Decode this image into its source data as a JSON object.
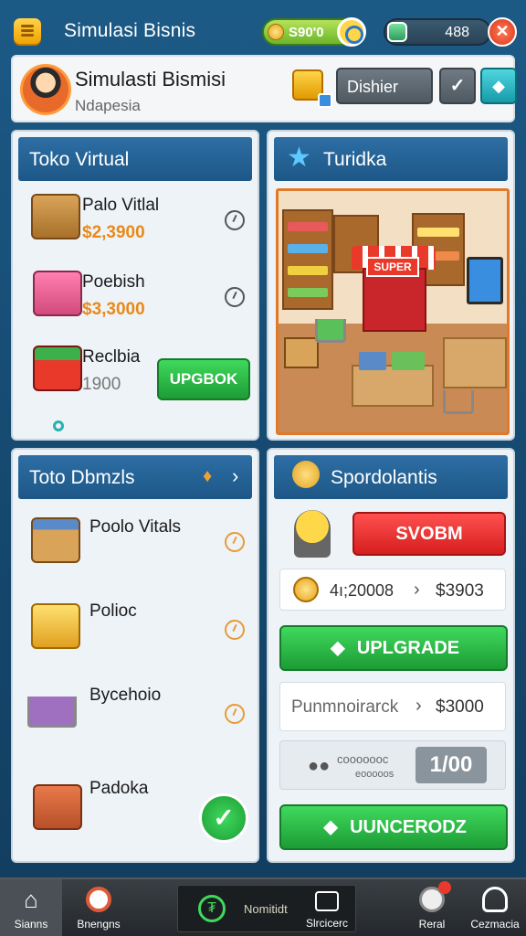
{
  "header": {
    "title": "Simulasi Bisnis",
    "money": "S90'0",
    "gems": "488"
  },
  "profile": {
    "name": "Simulasti Bismisi",
    "location": "Ndapesia",
    "dishier_label": "Dishier"
  },
  "toko_virtual": {
    "title": "Toko Virtual",
    "items": [
      {
        "name": "Palo Vitlal",
        "price": "$2,3900"
      },
      {
        "name": "Poebish",
        "price": "$3,3000"
      },
      {
        "name": "Reclbia",
        "price": "1900"
      }
    ],
    "action_label": "UPGBOK"
  },
  "store_view": {
    "title": "Turidka",
    "sign": "SUPER"
  },
  "toko_dbmzis": {
    "title": "Toto Dbmzls",
    "items": [
      {
        "name": "Poolo Vitals"
      },
      {
        "name": "Polioc"
      },
      {
        "name": "Bycehoio"
      },
      {
        "name": "Padoka"
      }
    ]
  },
  "spordolantis": {
    "title": "Spordolantis",
    "red_button": "SVOBM",
    "row1_amount": "4ı;20008",
    "row1_arrow": "›",
    "row1_price": "$3903",
    "upgrade_label": "UPLGRADE",
    "row2_label": "Punmnoirarck",
    "row2_arrow": "›",
    "row2_price": "$3000",
    "row3_line1": "cooooooc",
    "row3_line2": "eooooos",
    "row3_value": "1/00",
    "bottom_button": "UUNCERODZ"
  },
  "nav": {
    "items": [
      {
        "label": "Sianns"
      },
      {
        "label": "Bnengns"
      },
      {
        "label": "Nomitidt"
      },
      {
        "label": "Slrcicerc"
      },
      {
        "label": "Reral"
      },
      {
        "label": "Cezmacia"
      }
    ]
  }
}
